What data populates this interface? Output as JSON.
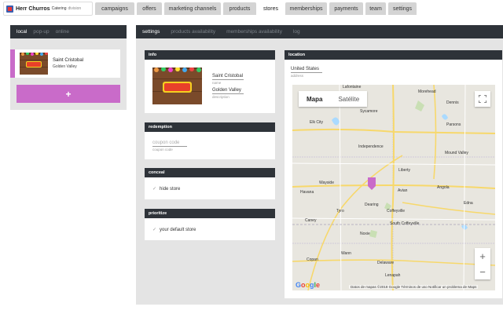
{
  "brand": {
    "name": "Herr Churros",
    "sub": "Catering",
    "division": "division"
  },
  "nav": {
    "tabs": [
      "campaigns",
      "offers",
      "marketing channels",
      "products",
      "stores",
      "memberships",
      "payments",
      "team",
      "settings"
    ],
    "active": "stores"
  },
  "left": {
    "tabs": [
      "local",
      "pop-up",
      "online"
    ],
    "active": "local",
    "store": {
      "name": "Saint Cristobal",
      "location": "Golden Valley"
    },
    "add_label": "+"
  },
  "right": {
    "tabs": [
      "settings",
      "products availability",
      "memberships availability",
      "log"
    ],
    "active": "settings"
  },
  "info": {
    "title": "info",
    "name_value": "Saint Cristobal",
    "name_label": "name",
    "description_value": "Golden Valley",
    "description_label": "description",
    "thumb_text": "Herr Churros"
  },
  "redemption": {
    "title": "redemption",
    "placeholder": "coupon code",
    "label": "coupon code"
  },
  "conceal": {
    "title": "conceal",
    "label": "hide store"
  },
  "prioritize": {
    "title": "prioritize",
    "label": "your default store"
  },
  "location": {
    "title": "location",
    "address_value": "United States",
    "address_label": "address",
    "map": {
      "btn_map": "Mapa",
      "btn_satellite": "Satélite",
      "places": [
        "Lafontaine",
        "Morehead",
        "Dennis",
        "Sycamore",
        "Elk City",
        "Parsons",
        "Independence",
        "Mound Valley",
        "Wayside",
        "Liberty",
        "Avian",
        "Angola",
        "Havana",
        "Tyro",
        "Dearing",
        "Coffeyville",
        "Edna",
        "Caney",
        "South Coffeyville",
        "Noxie",
        "Copan",
        "Wann",
        "Delaware",
        "Lenapah"
      ],
      "attribution": "Datos de mapas ©2018 Google   Términos de uso   Notificar un problema de Maps",
      "google": "Google"
    }
  },
  "colors": {
    "accent": "#c96bc9",
    "header": "#2e3339",
    "panel_bg": "#e4e4e4"
  }
}
